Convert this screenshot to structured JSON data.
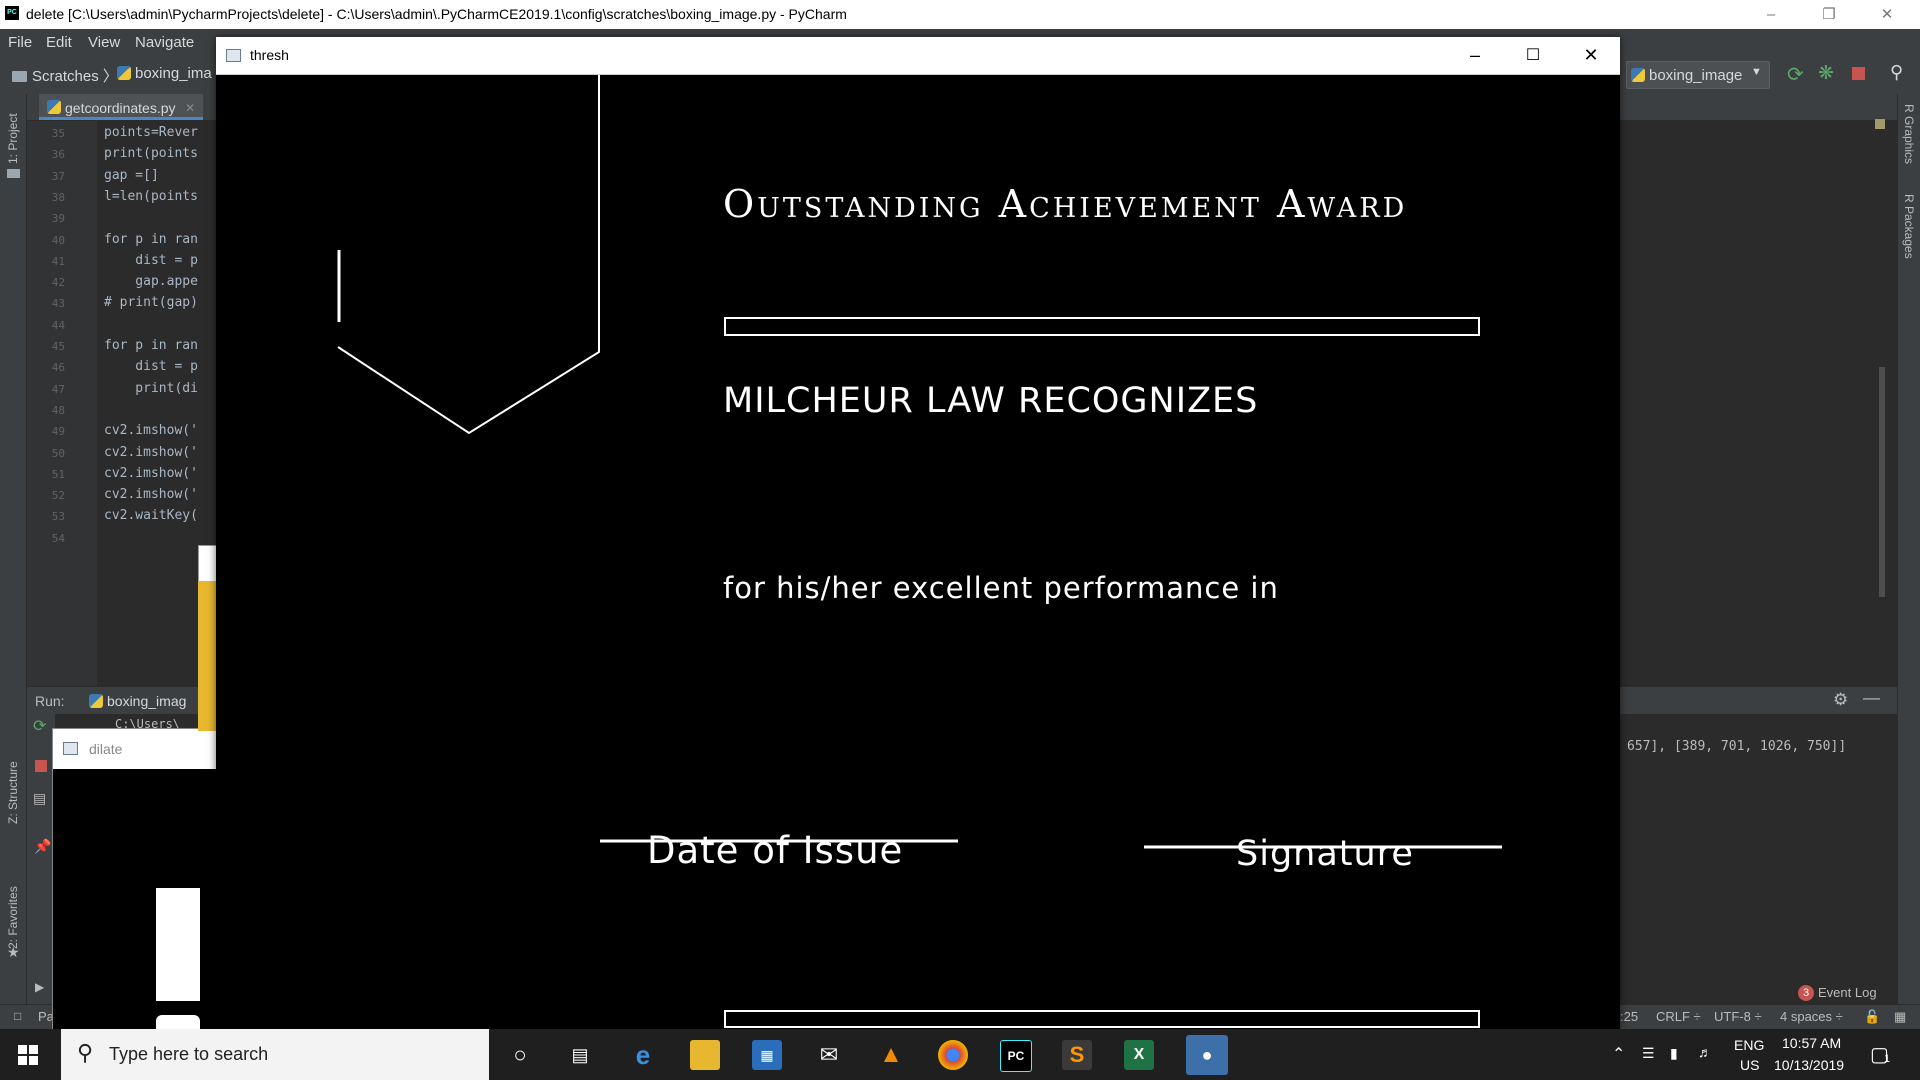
{
  "window": {
    "title": "delete [C:\\Users\\admin\\PycharmProjects\\delete] - C:\\Users\\admin\\.PyCharmCE2019.1\\config\\scratches\\boxing_image.py - PyCharm"
  },
  "menu": [
    "File",
    "Edit",
    "View",
    "Navigate"
  ],
  "breadcrumb": {
    "folder": "Scratches",
    "file": "boxing_ima"
  },
  "run_config": {
    "label": "boxing_image"
  },
  "left_tools": {
    "project": "1: Project",
    "structure": "Z: Structure",
    "favorites": "2: Favorites"
  },
  "right_tools": {
    "graphics": "R Graphics",
    "packages": "R Packages"
  },
  "editor": {
    "tab": "getcoordinates.py",
    "lines": [
      {
        "n": "35",
        "code": "points=Rever"
      },
      {
        "n": "36",
        "code": "print(points"
      },
      {
        "n": "37",
        "code": "gap =[]"
      },
      {
        "n": "38",
        "code": "l=len(points"
      },
      {
        "n": "39",
        "code": ""
      },
      {
        "n": "40",
        "code": "for p in ran"
      },
      {
        "n": "41",
        "code": "    dist = p"
      },
      {
        "n": "42",
        "code": "    gap.appe"
      },
      {
        "n": "43",
        "code": "# print(gap)"
      },
      {
        "n": "44",
        "code": ""
      },
      {
        "n": "45",
        "code": "for p in ran"
      },
      {
        "n": "46",
        "code": "    dist = p"
      },
      {
        "n": "47",
        "code": "    print(di"
      },
      {
        "n": "48",
        "code": ""
      },
      {
        "n": "49",
        "code": "cv2.imshow('"
      },
      {
        "n": "50",
        "code": "cv2.imshow('"
      },
      {
        "n": "51",
        "code": "cv2.imshow('"
      },
      {
        "n": "52",
        "code": "cv2.imshow('"
      },
      {
        "n": "53",
        "code": "cv2.waitKey("
      },
      {
        "n": "54",
        "code": ""
      }
    ]
  },
  "run": {
    "label": "Run:",
    "tab": "boxing_imag",
    "console_path": "C:\\Users\\",
    "console_output": "657], [389, 701, 1026, 750]]"
  },
  "dilate_window": {
    "title": "dilate"
  },
  "thresh_window": {
    "title": "thresh",
    "certificate": {
      "heading": "Outstanding Achievement Award",
      "recognizes": "MILCHEUR LAW RECOGNIZES",
      "performance": "for his/her excellent performance in",
      "date_label": "Date of Issue",
      "signature_label": "Signature"
    }
  },
  "status": {
    "left": "Pa",
    "event_log": "Event Log",
    "event_count": "3",
    "position": ":25",
    "line_sep": "CRLF ÷",
    "encoding": "UTF-8 ÷",
    "indent": "4 spaces ÷"
  },
  "taskbar": {
    "search_placeholder": "Type here to search",
    "lang": "ENG",
    "region": "US",
    "time": "10:57 AM",
    "date": "10/13/2019",
    "notifications": "1"
  }
}
